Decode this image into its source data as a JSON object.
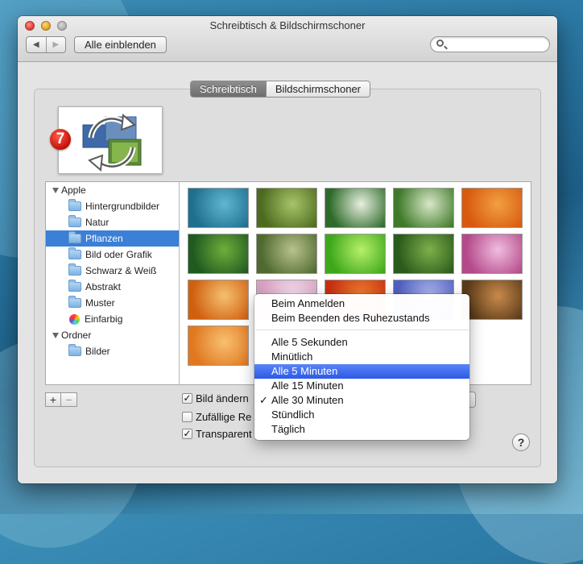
{
  "window": {
    "title": "Schreibtisch & Bildschirmschoner"
  },
  "toolbar": {
    "back_icon": "chevron-left-icon",
    "forward_icon": "chevron-right-icon",
    "show_all": "Alle einblenden",
    "search_placeholder": ""
  },
  "tabs": [
    {
      "label": "Schreibtisch",
      "active": true
    },
    {
      "label": "Bildschirmschoner",
      "active": false
    }
  ],
  "badge": {
    "value": "7"
  },
  "sidebar": {
    "items": [
      {
        "label": "Apple",
        "type": "group",
        "expanded": true
      },
      {
        "label": "Hintergrundbilder",
        "type": "folder"
      },
      {
        "label": "Natur",
        "type": "folder"
      },
      {
        "label": "Pflanzen",
        "type": "folder",
        "selected": true
      },
      {
        "label": "Bild oder Grafik",
        "type": "folder"
      },
      {
        "label": "Schwarz & Weiß",
        "type": "folder"
      },
      {
        "label": "Abstrakt",
        "type": "folder"
      },
      {
        "label": "Muster",
        "type": "folder"
      },
      {
        "label": "Einfarbig",
        "type": "colors"
      },
      {
        "label": "Ordner",
        "type": "group",
        "expanded": true
      },
      {
        "label": "Bilder",
        "type": "folder"
      }
    ]
  },
  "thumbnails": [
    {
      "name": "agave",
      "colors": [
        "#1f6f8f",
        "#5fb7d0"
      ]
    },
    {
      "name": "bamboo",
      "colors": [
        "#4d6b1e",
        "#a8c46a"
      ]
    },
    {
      "name": "white-flowers",
      "colors": [
        "#2e6b2a",
        "#e8efe0"
      ]
    },
    {
      "name": "dandelion",
      "colors": [
        "#3f7a2a",
        "#d9e7c8"
      ]
    },
    {
      "name": "orange-petals",
      "colors": [
        "#d85a10",
        "#f2a040"
      ]
    },
    {
      "name": "grass",
      "colors": [
        "#1f5a20",
        "#6fae3a"
      ]
    },
    {
      "name": "reeds",
      "colors": [
        "#4f6a2e",
        "#b9c28e"
      ]
    },
    {
      "name": "green-leaf",
      "colors": [
        "#3ea81a",
        "#b7f06a"
      ]
    },
    {
      "name": "green-bush",
      "colors": [
        "#2a5a1c",
        "#7fb04a"
      ]
    },
    {
      "name": "pink-lotus",
      "colors": [
        "#b44a8a",
        "#f0bde0"
      ]
    },
    {
      "name": "maple-leaves",
      "colors": [
        "#d06010",
        "#f5c070"
      ]
    },
    {
      "name": "pink-blossom",
      "colors": [
        "#d8a0c0",
        "#f4e0ee"
      ]
    },
    {
      "name": "red-rose",
      "colors": [
        "#c83010",
        "#f08030"
      ]
    },
    {
      "name": "blue-petals",
      "colors": [
        "#5060c0",
        "#b0b8f0"
      ]
    },
    {
      "name": "redwoods",
      "colors": [
        "#5a3a1a",
        "#c88a4a"
      ]
    },
    {
      "name": "tree-rings",
      "colors": [
        "#e07820",
        "#f8c070"
      ]
    }
  ],
  "options": {
    "change_picture": {
      "label": "Bild ändern",
      "checked": true
    },
    "random_order": {
      "label": "Zufällige Re",
      "checked": false
    },
    "translucent_menu": {
      "label": "Transparent",
      "checked": true
    }
  },
  "interval_menu": {
    "items": [
      {
        "label": "Beim Anmelden"
      },
      {
        "label": "Beim Beenden des Ruhezustands"
      },
      {
        "separator": true
      },
      {
        "label": "Alle 5 Sekunden"
      },
      {
        "label": "Minütlich"
      },
      {
        "label": "Alle 5 Minuten",
        "highlighted": true
      },
      {
        "label": "Alle 15 Minuten"
      },
      {
        "label": "Alle 30 Minuten",
        "checked": true
      },
      {
        "label": "Stündlich"
      },
      {
        "label": "Täglich"
      }
    ]
  },
  "help": {
    "label": "?"
  },
  "plusminus": {
    "plus": "+",
    "minus": "−"
  },
  "check_glyph": "✓"
}
